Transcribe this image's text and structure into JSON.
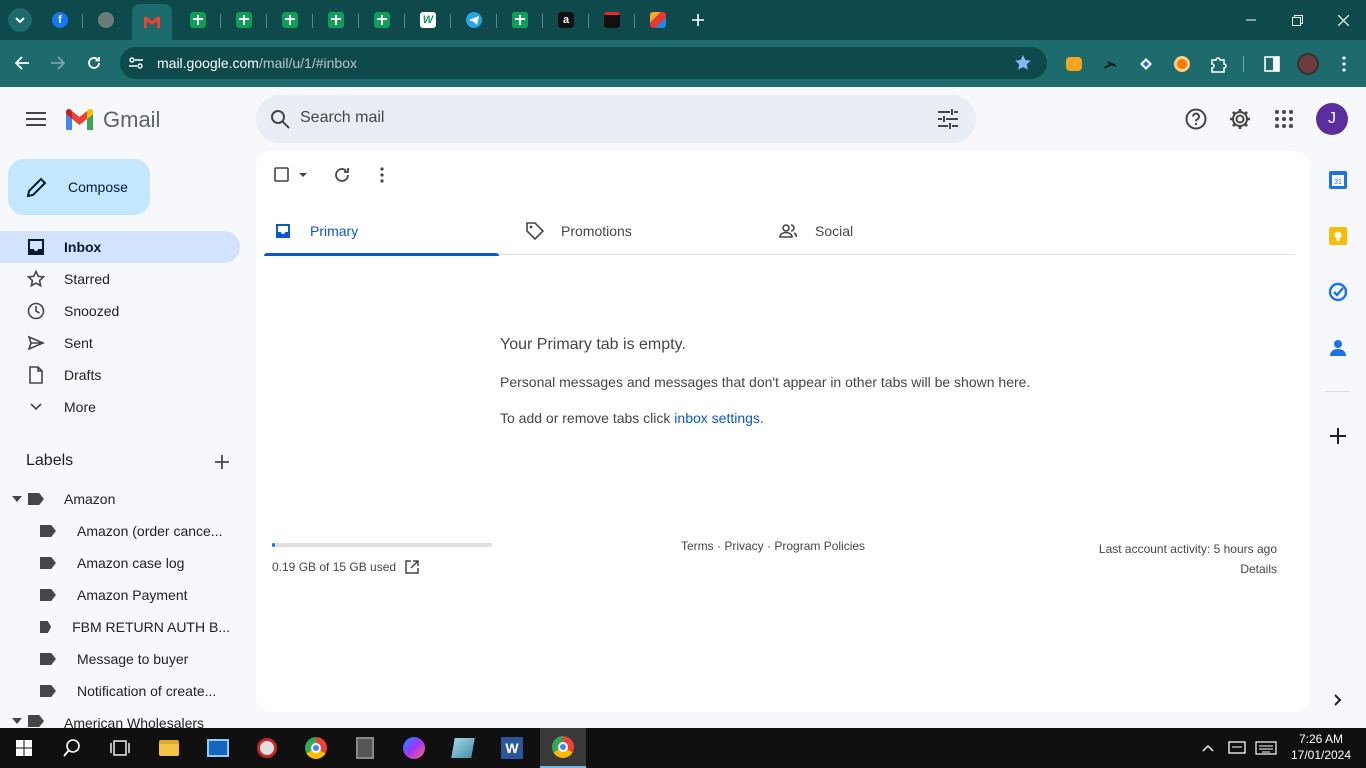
{
  "browser": {
    "tabs": [
      {
        "icon": "facebook-icon"
      },
      {
        "icon": "globe-icon"
      },
      {
        "icon": "gmail-icon",
        "active": true
      },
      {
        "icon": "sheets-icon"
      },
      {
        "icon": "sheets-icon"
      },
      {
        "icon": "sheets-icon"
      },
      {
        "icon": "sheets-icon"
      },
      {
        "icon": "sheets-icon"
      },
      {
        "icon": "w-icon"
      },
      {
        "icon": "telegram-icon"
      },
      {
        "icon": "sheets-icon"
      },
      {
        "icon": "amazon-icon"
      },
      {
        "icon": "red-tab-icon"
      },
      {
        "icon": "multicolor-icon"
      }
    ],
    "url_host": "mail.google.com",
    "url_path": "/mail/u/1/#inbox",
    "colors": {
      "tabstrip": "#0e4a4c",
      "toolbar": "#1d6b6d"
    }
  },
  "gmail": {
    "logo_text": "Gmail",
    "search_placeholder": "Search mail",
    "avatar_letter": "J",
    "compose_label": "Compose",
    "nav": [
      {
        "label": "Inbox",
        "icon": "inbox-icon",
        "active": true
      },
      {
        "label": "Starred",
        "icon": "star-icon"
      },
      {
        "label": "Snoozed",
        "icon": "clock-icon"
      },
      {
        "label": "Sent",
        "icon": "send-icon"
      },
      {
        "label": "Drafts",
        "icon": "draft-icon"
      },
      {
        "label": "More",
        "icon": "chevron-down-icon"
      }
    ],
    "labels_title": "Labels",
    "labels": [
      {
        "label": "Amazon",
        "parent": true
      },
      {
        "label": "Amazon (order cance..."
      },
      {
        "label": "Amazon case log"
      },
      {
        "label": "Amazon Payment"
      },
      {
        "label": "FBM RETURN AUTH B..."
      },
      {
        "label": "Message to buyer"
      },
      {
        "label": "Notification of create..."
      },
      {
        "label": "American Wholesalers",
        "parent": true
      }
    ],
    "tabs": [
      {
        "label": "Primary",
        "icon": "inbox-icon",
        "active": true
      },
      {
        "label": "Promotions",
        "icon": "tag-icon"
      },
      {
        "label": "Social",
        "icon": "people-icon"
      }
    ],
    "empty": {
      "title": "Your Primary tab is empty.",
      "line1": "Personal messages and messages that don't appear in other tabs will be shown here.",
      "line2_prefix": "To add or remove tabs click ",
      "line2_link": "inbox settings",
      "line2_suffix": "."
    },
    "footer": {
      "storage": "0.19 GB of 15 GB used",
      "storage_fraction": 0.0127,
      "terms": "Terms",
      "dot1": " · ",
      "privacy": "Privacy",
      "dot2": " · ",
      "policies": "Program Policies",
      "activity": "Last account activity: 5 hours ago",
      "details": "Details"
    }
  },
  "taskbar": {
    "time": "7:26 AM",
    "date": "17/01/2024"
  }
}
